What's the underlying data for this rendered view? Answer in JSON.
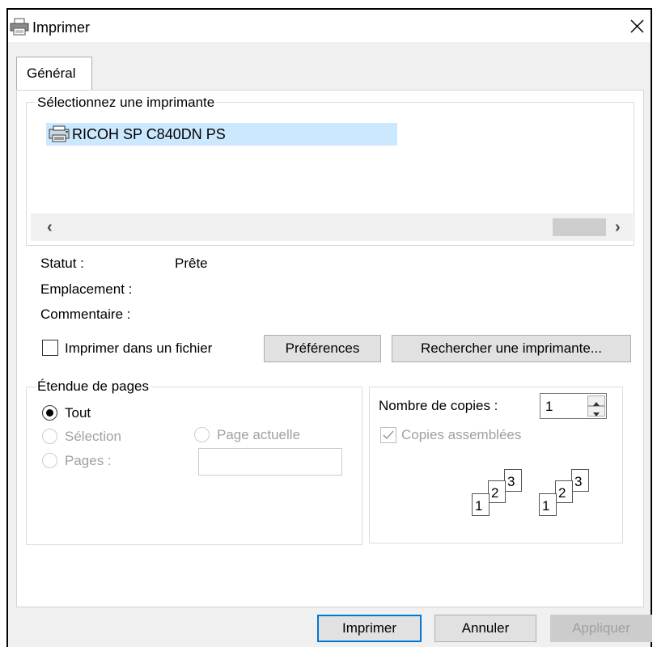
{
  "window": {
    "title": "Imprimer"
  },
  "tabs": [
    {
      "label": "Général"
    }
  ],
  "printer_group": {
    "legend": "Sélectionnez une imprimante",
    "printers": [
      {
        "name": "RICOH SP C840DN PS",
        "selected": true
      }
    ],
    "scroll_left": "‹",
    "scroll_right": "›"
  },
  "info": {
    "status_label": "Statut :",
    "status_value": "Prête",
    "location_label": "Emplacement :",
    "comment_label": "Commentaire :"
  },
  "print_to_file": {
    "label": "Imprimer dans un fichier",
    "checked": false
  },
  "buttons": {
    "preferences": "Préférences",
    "find_printer": "Rechercher une imprimante...",
    "print": "Imprimer",
    "cancel": "Annuler",
    "apply": "Appliquer"
  },
  "page_range": {
    "legend": "Étendue de pages",
    "all": "Tout",
    "selection": "Sélection",
    "current_page": "Page actuelle",
    "pages": "Pages :",
    "selected": "all",
    "pages_value": ""
  },
  "copies": {
    "label": "Nombre de copies :",
    "value": "1",
    "collate_label": "Copies assemblées",
    "collate_checked": true,
    "collate_digits": [
      "1",
      "2",
      "3"
    ]
  },
  "colors": {
    "selection": "#cce8ff",
    "default_button_border": "#0078d7",
    "dialog_bg": "#f0f0f0"
  },
  "icons": [
    "printer-icon",
    "close-icon",
    "printer-item-icon",
    "scroll-left-icon",
    "scroll-right-icon",
    "spin-up-icon",
    "spin-down-icon",
    "collate-icon"
  ]
}
